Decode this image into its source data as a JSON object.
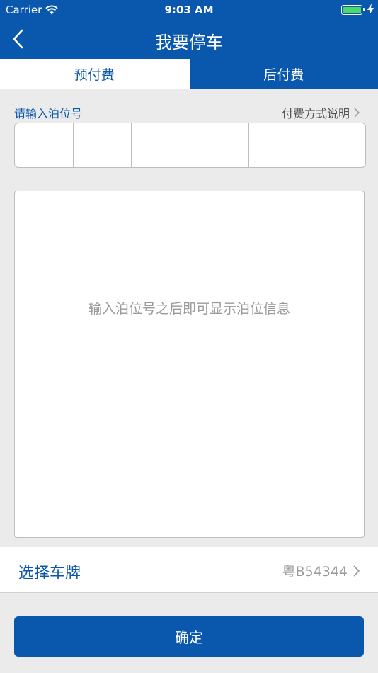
{
  "status_bar": {
    "carrier": "Carrier",
    "time": "9:03 AM"
  },
  "nav": {
    "title": "我要停车",
    "back_icon": "chevron-left-icon"
  },
  "tabs": [
    {
      "label": "预付费",
      "selected": false
    },
    {
      "label": "后付费",
      "selected": true
    }
  ],
  "berth": {
    "label": "请输入泊位号",
    "payment_info_link": "付费方式说明",
    "digit_boxes": [
      "",
      "",
      "",
      "",
      "",
      ""
    ]
  },
  "info_area": {
    "hint": "输入泊位号之后即可显示泊位信息"
  },
  "plate": {
    "label": "选择车牌",
    "value": "粤B54344"
  },
  "confirm_button": {
    "label": "确定"
  },
  "colors": {
    "brand": "#0a58ad",
    "background": "#ebebeb",
    "battery": "#4cd964"
  }
}
